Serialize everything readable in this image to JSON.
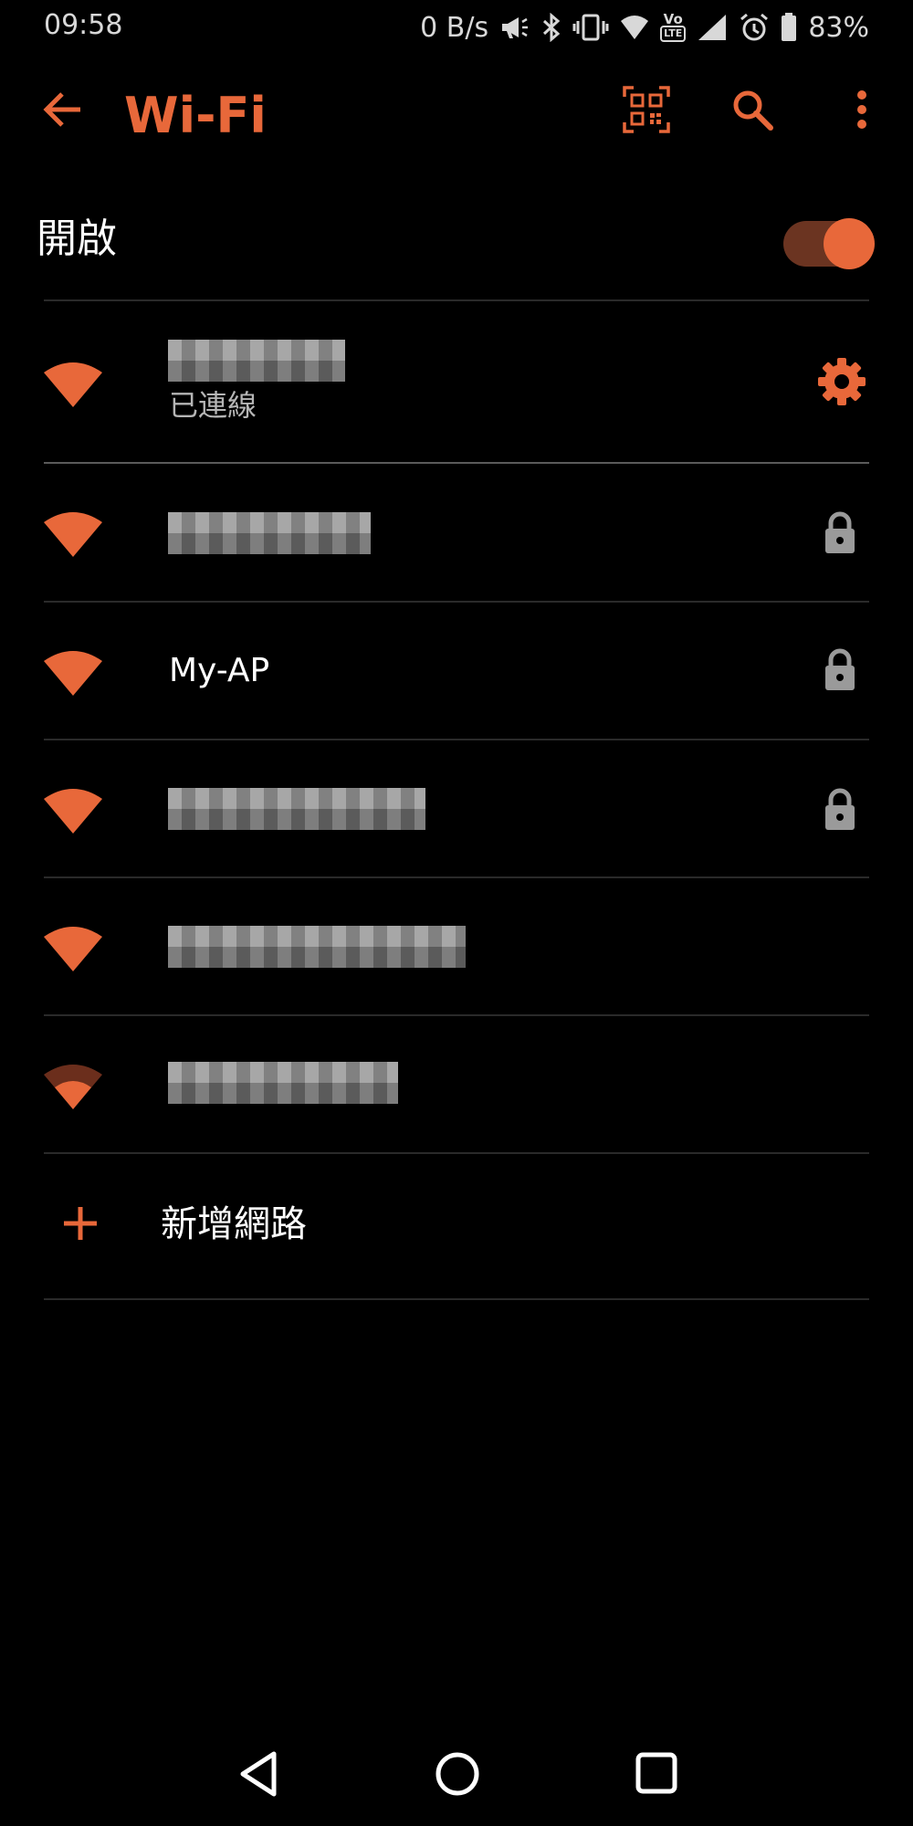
{
  "status_bar": {
    "time": "09:58",
    "data_rate": "0 B/s",
    "volte_label_top": "Vo",
    "volte_label_bottom": "LTE",
    "battery": "83%",
    "icons": [
      "megaphone-icon",
      "bluetooth-icon",
      "vibrate-icon",
      "wifi-icon",
      "volte-icon",
      "cell-signal-icon",
      "alarm-icon",
      "battery-icon"
    ]
  },
  "app_bar": {
    "title": "Wi-Fi",
    "back_icon": "arrow-back-icon",
    "actions": [
      "qr-code-scan-icon",
      "search-icon",
      "more-vert-icon"
    ]
  },
  "master_toggle": {
    "label": "開啟",
    "state": "on"
  },
  "networks": [
    {
      "name": "",
      "name_redacted": true,
      "status": "已連線",
      "signal": "full",
      "secured": false,
      "action_icon": "gear-icon"
    },
    {
      "name": "",
      "name_redacted": true,
      "status": "",
      "signal": "full",
      "secured": true
    },
    {
      "name": "My-AP",
      "name_redacted": false,
      "status": "",
      "signal": "full",
      "secured": true
    },
    {
      "name": "",
      "name_redacted": true,
      "status": "",
      "signal": "full",
      "secured": true
    },
    {
      "name": "",
      "name_redacted": true,
      "status": "",
      "signal": "full",
      "secured": false
    },
    {
      "name": "",
      "name_redacted": true,
      "status": "",
      "signal": "weak",
      "secured": false
    }
  ],
  "add_network": {
    "label": "新增網路",
    "icon": "add-icon"
  },
  "nav_bar": {
    "buttons": [
      "nav-back-icon",
      "nav-home-icon",
      "nav-recents-icon"
    ]
  },
  "colors": {
    "accent": "#e8683a",
    "switch_track": "#6b3421",
    "background": "#000000",
    "secondary_text": "#b5b5b5",
    "divider": "#2a2a2a",
    "lock": "#9a9a9a"
  }
}
